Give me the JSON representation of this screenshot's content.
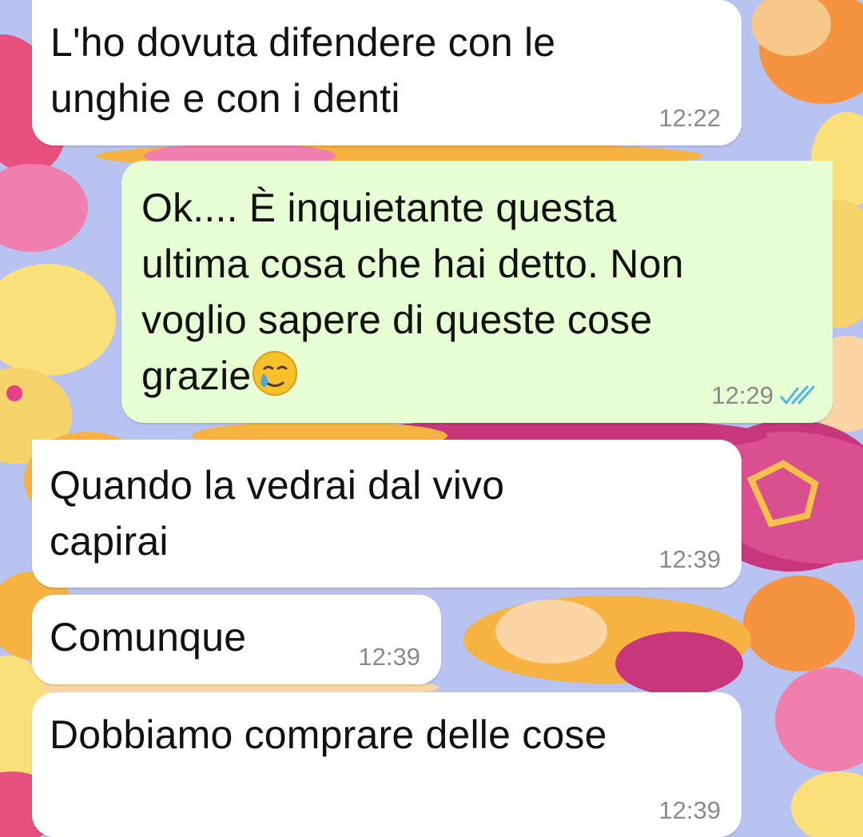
{
  "chat": {
    "messages": [
      {
        "direction": "incoming",
        "text": "L'ho dovuta difendere con le\nunghie e con i denti",
        "time": "12:22"
      },
      {
        "direction": "outgoing",
        "text": "Ok.... È inquietante questa\nultima cosa che hai detto. Non\nvoglio sapere di queste cose\ngrazie",
        "emoji": "crying-smile-face",
        "time": "12:29",
        "status": "read",
        "status_color": "#4fb6ec"
      },
      {
        "direction": "incoming",
        "text": "Quando la vedrai dal vivo\ncapirai",
        "time": "12:39"
      },
      {
        "direction": "incoming",
        "text": "Comunque",
        "time": "12:39"
      },
      {
        "direction": "incoming",
        "text": "Dobbiamo comprare delle cose",
        "time": "12:39"
      }
    ]
  },
  "colors": {
    "incoming_bubble": "#ffffff",
    "outgoing_bubble": "#e7fdd4",
    "timestamp": "#8a8a8a",
    "wallpaper_base": "#b9c3f2"
  }
}
